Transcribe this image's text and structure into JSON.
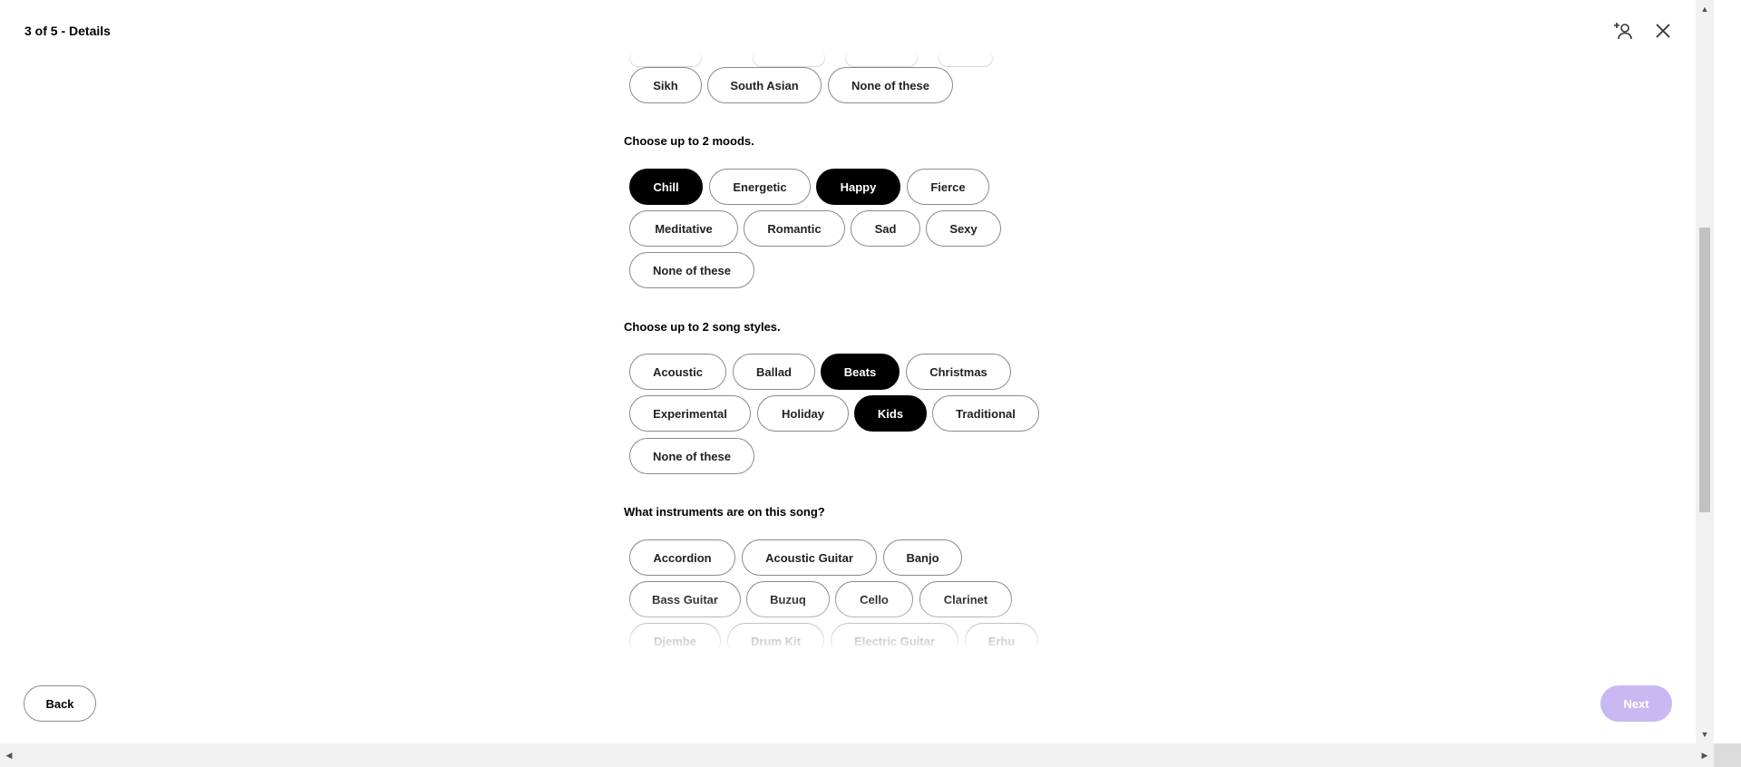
{
  "header": {
    "title": "3 of 5 - Details",
    "add_person_icon": "add-person-icon",
    "close_icon": "close-icon"
  },
  "top_row": {
    "options": [
      "Sikh",
      "South Asian",
      "None of these"
    ]
  },
  "moods": {
    "question": "Choose up to 2 moods.",
    "options": [
      "Chill",
      "Energetic",
      "Happy",
      "Fierce",
      "Meditative",
      "Romantic",
      "Sad",
      "Sexy",
      "None of these"
    ],
    "selected": [
      "Chill",
      "Happy"
    ]
  },
  "styles": {
    "question": "Choose up to 2 song styles.",
    "options": [
      "Acoustic",
      "Ballad",
      "Beats",
      "Christmas",
      "Experimental",
      "Holiday",
      "Kids",
      "Traditional",
      "None of these"
    ],
    "selected": [
      "Beats",
      "Kids"
    ]
  },
  "instruments": {
    "question": "What instruments are on this song?",
    "options": [
      "Accordion",
      "Acoustic Guitar",
      "Banjo",
      "Bass Guitar",
      "Buzuq",
      "Cello",
      "Clarinet",
      "Djembe",
      "Drum Kit",
      "Electric Guitar",
      "Erhu"
    ]
  },
  "footer": {
    "back_label": "Back",
    "next_label": "Next"
  },
  "colors": {
    "selected_chip": "#000000",
    "next_disabled": "#c9b8f2"
  }
}
